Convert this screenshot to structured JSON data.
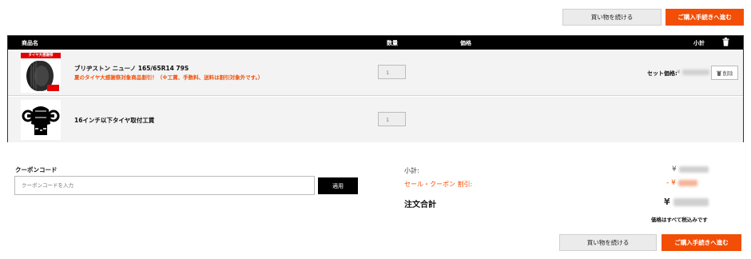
{
  "top_actions": {
    "continue_label": "買い物を続ける",
    "checkout_label": "ご購入手続きへ進む"
  },
  "table": {
    "headers": {
      "product": "商品名",
      "qty": "数量",
      "price": "価格",
      "subtotal": "小計"
    },
    "rows": [
      {
        "thumb_badge": "タイヤ大感謝祭",
        "name": "ブリヂストン ニューノ 165/65R14 79S",
        "promo": "夏のタイヤ大感謝祭対象商品割引！（※工賃、手数料、送料は割引対象外です。）",
        "qty": "1",
        "set_price_label": "セット価格:",
        "set_price_prefix": "¥",
        "delete_label": "削除"
      },
      {
        "name": "16インチ以下タイヤ取付工賃",
        "qty": "1"
      }
    ]
  },
  "coupon": {
    "title": "クーポンコード",
    "placeholder": "クーポンコードを入力",
    "apply_label": "適用"
  },
  "summary": {
    "subtotal_label": "小計:",
    "subtotal_prefix": "¥",
    "discount_label": "セール・クーポン 割引:",
    "discount_prefix": "- ¥",
    "total_label": "注文合計",
    "total_prefix": "¥",
    "tax_note": "価格はすべて税込みです"
  },
  "bottom_actions": {
    "continue_label": "買い物を続ける",
    "checkout_label": "ご購入手続きへ進む"
  },
  "colors": {
    "accent": "#f24e06",
    "header_bg": "#000000",
    "row_bg": "#f3f3f3"
  }
}
